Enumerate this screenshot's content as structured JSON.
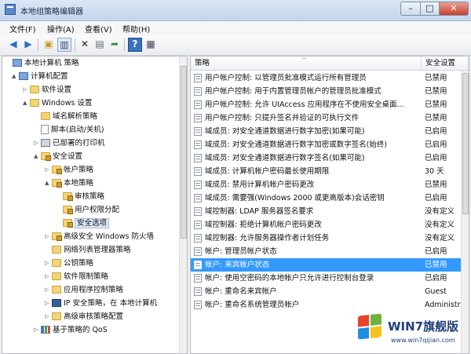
{
  "window": {
    "title": "本地组策略编辑器"
  },
  "menu": [
    "文件(F)",
    "操作(A)",
    "查看(V)",
    "帮助(H)"
  ],
  "colors": {
    "selection": "#3399ff",
    "folder": "#f3d477",
    "accent": "#1f3f7a"
  },
  "toolbar_icons": [
    "back-arrow-icon",
    "forward-arrow-icon",
    "up-folder-icon",
    "show-tree-icon",
    "delete-icon",
    "properties-icon",
    "export-icon",
    "help-icon",
    "console-icon"
  ],
  "tree": [
    {
      "label": "本地计算机 策略",
      "icon": "computer-icon",
      "expander": ""
    },
    {
      "label": "计算机配置",
      "icon": "computer-icon",
      "expander": "▲"
    },
    {
      "label": "软件设置",
      "icon": "folder-icon",
      "expander": "▷"
    },
    {
      "label": "Windows 设置",
      "icon": "folder-icon",
      "expander": "▲"
    },
    {
      "label": "域名解析策略",
      "icon": "folder-icon",
      "expander": ""
    },
    {
      "label": "脚本(启动/关机)",
      "icon": "script-icon",
      "expander": ""
    },
    {
      "label": "已部署的打印机",
      "icon": "printer-icon",
      "expander": "▷"
    },
    {
      "label": "安全设置",
      "icon": "lock-folder-icon",
      "expander": "▲"
    },
    {
      "label": "帐户策略",
      "icon": "lock-folder-icon",
      "expander": "▷"
    },
    {
      "label": "本地策略",
      "icon": "lock-folder-icon",
      "expander": "▲"
    },
    {
      "label": "审核策略",
      "icon": "lock-folder-icon",
      "expander": ""
    },
    {
      "label": "用户权限分配",
      "icon": "lock-folder-icon",
      "expander": ""
    },
    {
      "label": "安全选项",
      "icon": "lock-folder-icon",
      "expander": "",
      "selected": true
    },
    {
      "label": "高级安全 Windows 防火墙",
      "icon": "lock-folder-icon",
      "expander": "▷"
    },
    {
      "label": "网络列表管理器策略",
      "icon": "folder-icon",
      "expander": ""
    },
    {
      "label": "公钥策略",
      "icon": "folder-icon",
      "expander": "▷"
    },
    {
      "label": "软件限制策略",
      "icon": "folder-icon",
      "expander": "▷"
    },
    {
      "label": "应用程序控制策略",
      "icon": "folder-icon",
      "expander": "▷"
    },
    {
      "label": "IP 安全策略，在 本地计算机",
      "icon": "shield-icon",
      "expander": "▷"
    },
    {
      "label": "高级审核策略配置",
      "icon": "folder-icon",
      "expander": "▷"
    },
    {
      "label": "基于策略的 QoS",
      "icon": "chart-icon",
      "expander": "▷"
    }
  ],
  "list": {
    "columns": [
      "策略",
      "安全设置"
    ],
    "rows": [
      {
        "policy": "用户帐户控制: 以管理员批准模式运行所有管理员",
        "setting": "已禁用"
      },
      {
        "policy": "用户帐户控制: 用于内置管理员帐户的管理员批准模式",
        "setting": "已禁用"
      },
      {
        "policy": "用户帐户控制: 允许 UIAccess 应用程序在不使用安全桌面...",
        "setting": "已禁用"
      },
      {
        "policy": "用户帐户控制: 只提升签名并验证的可执行文件",
        "setting": "已禁用"
      },
      {
        "policy": "域成员: 对安全通道数据进行数字加密(如果可能)",
        "setting": "已启用"
      },
      {
        "policy": "域成员: 对安全通道数据进行数字加密或数字签名(始终)",
        "setting": "已启用"
      },
      {
        "policy": "域成员: 对安全通道数据进行数字签名(如果可能)",
        "setting": "已启用"
      },
      {
        "policy": "域成员: 计算机帐户密码最长使用期限",
        "setting": "30 天"
      },
      {
        "policy": "域成员: 禁用计算机帐户密码更改",
        "setting": "已禁用"
      },
      {
        "policy": "域成员: 需要强(Windows 2000 或更高版本)会话密钥",
        "setting": "已启用"
      },
      {
        "policy": "域控制器: LDAP 服务器签名要求",
        "setting": "没有定义"
      },
      {
        "policy": "域控制器: 拒绝计算机帐户密码更改",
        "setting": "没有定义"
      },
      {
        "policy": "域控制器: 允许服务器操作者计划任务",
        "setting": "没有定义"
      },
      {
        "policy": "帐户: 管理员帐户状态",
        "setting": "已启用"
      },
      {
        "policy": "帐户: 来宾帐户状态",
        "setting": "已禁用",
        "selected": true
      },
      {
        "policy": "帐户: 使用空密码的本地帐户只允许进行控制台登录",
        "setting": "已启用"
      },
      {
        "policy": "帐户: 重命名来宾帐户",
        "setting": "Guest"
      },
      {
        "policy": "帐户: 重命名系统管理员帐户",
        "setting": "Administrator"
      }
    ]
  },
  "watermark": {
    "title": "WIN7旗舰版",
    "url": "www.win7qijian.com"
  }
}
